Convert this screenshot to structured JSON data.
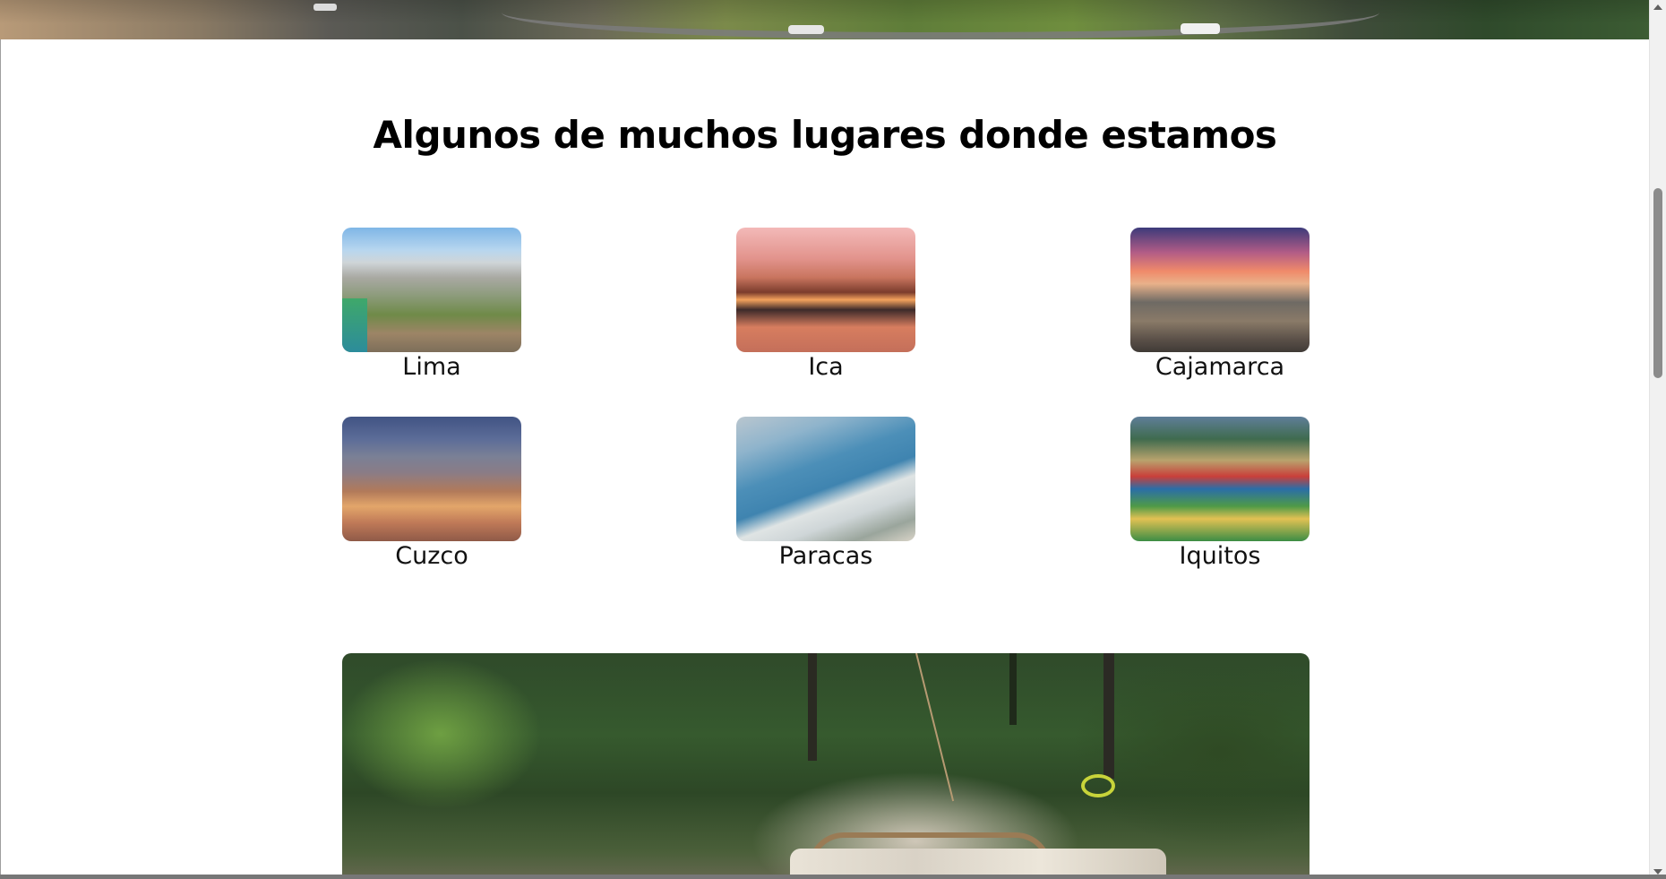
{
  "section": {
    "title": "Algunos de muchos lugares donde estamos"
  },
  "places": [
    {
      "name": "Lima",
      "thumb_icon": "lima-photo"
    },
    {
      "name": "Ica",
      "thumb_icon": "ica-photo"
    },
    {
      "name": "Cajamarca",
      "thumb_icon": "cajamarca-photo"
    },
    {
      "name": "Cuzco",
      "thumb_icon": "cuzco-photo"
    },
    {
      "name": "Paracas",
      "thumb_icon": "paracas-photo"
    },
    {
      "name": "Iquitos",
      "thumb_icon": "iquitos-photo"
    }
  ],
  "colors": {
    "background": "#ffffff",
    "title": "#000000",
    "label": "#111111",
    "scroll_thumb": "#8b8b8b"
  }
}
